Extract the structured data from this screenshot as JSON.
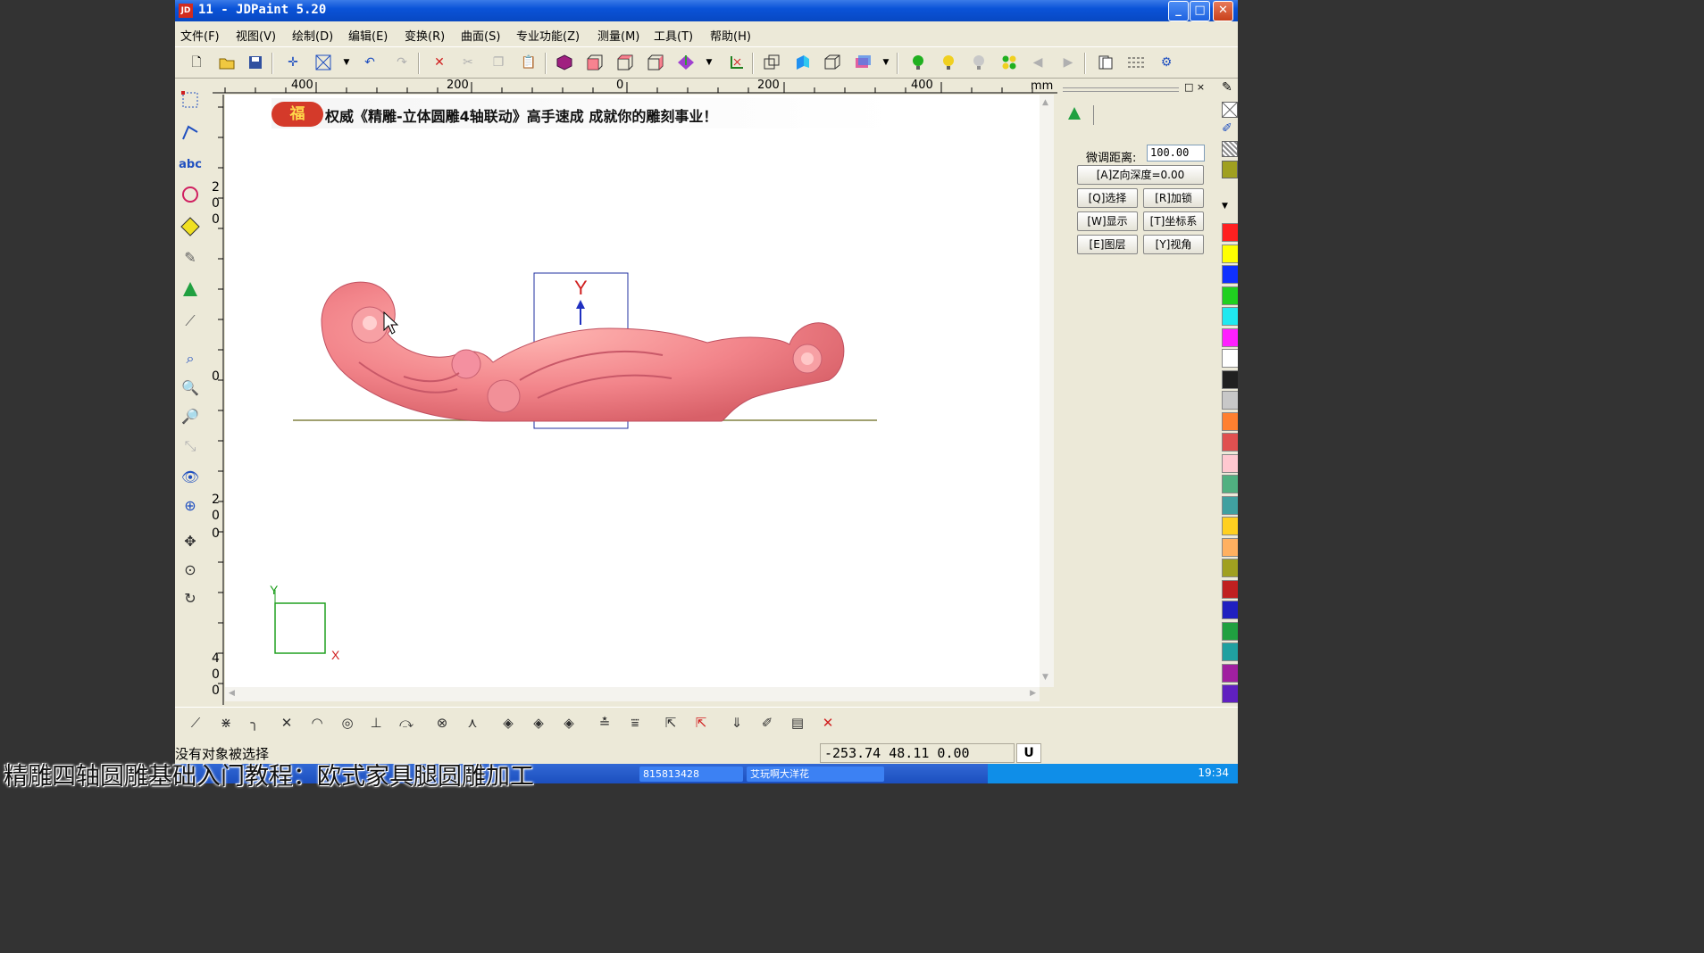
{
  "window": {
    "title": "11 - JDPaint 5.20",
    "app_icon_text": "JD",
    "controls": {
      "minimize": "_",
      "maximize": "□",
      "close": "✕"
    }
  },
  "menu": [
    "文件(F)",
    "视图(V)",
    "绘制(D)",
    "编辑(E)",
    "变换(R)",
    "曲面(S)",
    "专业功能(Z)",
    "测量(M)",
    "工具(T)",
    "帮助(H)"
  ],
  "toolbar_icons": [
    "new-icon",
    "open-icon",
    "save-icon",
    "crosshair-icon",
    "select-box-icon",
    "dropdown-icon",
    "undo-icon",
    "redo-icon",
    "delete-icon",
    "cut-icon",
    "copy-icon",
    "paste-icon",
    "solid-view-icon",
    "view-front-icon",
    "view-top-icon",
    "view-side-icon",
    "view-iso-icon",
    "dropdown-icon",
    "axis-icon",
    "view-box-icon",
    "shade-icon",
    "wireframe-icon",
    "render-icon",
    "dropdown-icon",
    "light-green-icon",
    "light-yellow-icon",
    "light-off-icon",
    "light-group-icon",
    "prev-icon",
    "next-icon",
    "layers-icon",
    "grid-icon",
    "settings-icon"
  ],
  "ruler": {
    "top_labels": [
      "400",
      "200",
      "0",
      "200",
      "400",
      "mm"
    ],
    "left_labels": [
      "2",
      "0",
      "0",
      "0",
      "2",
      "0",
      "0",
      "4",
      "0",
      "0"
    ]
  },
  "canvas": {
    "banner_badge": "福",
    "banner_text": "权威《精雕-立体圆雕4轴联动》高手速成 成就你的雕刻事业！",
    "y_axis_label": "Y",
    "corner_axis_y": "Y",
    "corner_axis_x": "X"
  },
  "right_panel": {
    "distance_label": "微调距离:",
    "distance_value": "100.00",
    "buttons": {
      "z_depth": "[A]Z向深度=0.00",
      "select": "[Q]选择",
      "lock": "[R]加锁",
      "display": "[W]显示",
      "coord": "[T]坐标系",
      "layer": "[E]图层",
      "view": "[Y]视角"
    },
    "head_controls": "□ ×"
  },
  "palette_colors": [
    "#ff2020",
    "#ffff00",
    "#1030ff",
    "#20d020",
    "#20e8f0",
    "#ff20ff",
    "#ffffff",
    "#202020",
    "#c8c8c8",
    "#ff8030",
    "#e05050",
    "#ffc8d0",
    "#50b080",
    "#40a0a0",
    "#ffd020",
    "#ffb060",
    "#a0a020",
    "#c02020",
    "#2020c0",
    "#20a040",
    "#20a0a0",
    "#a020a0",
    "#6020c0"
  ],
  "status": {
    "message": "没有对象被选择",
    "coords": "-253.74 48.11 0.00",
    "mode": "U"
  },
  "taskbar": {
    "items": [
      "815813428",
      "艾玩啊大洋花"
    ],
    "clock": "19:34"
  },
  "subtitle": "精雕四轴圆雕基础入门教程：欧式家具腿圆雕加工"
}
